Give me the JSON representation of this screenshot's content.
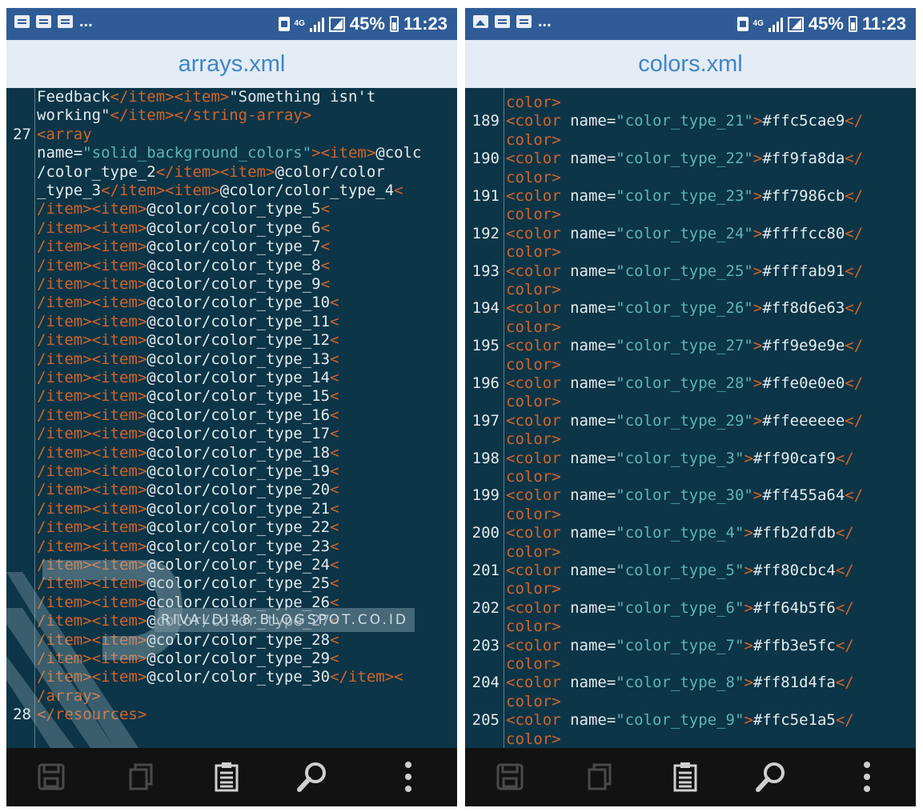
{
  "status_bar": {
    "signal_label": "4G",
    "battery": "45%",
    "time": "11:23",
    "overflow": "..."
  },
  "left_panel": {
    "title": "arrays.xml",
    "lines": [
      {
        "ln": "",
        "parts": [
          [
            "x",
            "Feedback"
          ],
          [
            "t",
            "</item><item>"
          ],
          [
            "x",
            "\"Something isn't"
          ]
        ]
      },
      {
        "ln": "",
        "parts": [
          [
            "x",
            "working\""
          ],
          [
            "t",
            "</item></string-array>"
          ]
        ]
      },
      {
        "ln": "27",
        "parts": [
          [
            "t",
            "<array"
          ]
        ]
      },
      {
        "ln": "",
        "parts": [
          [
            "a",
            "name="
          ],
          [
            "s",
            "\"solid_background_colors\""
          ],
          [
            "t",
            "><item>"
          ],
          [
            "x",
            "@colc"
          ]
        ]
      },
      {
        "ln": "",
        "parts": [
          [
            "x",
            "/color_type_2"
          ],
          [
            "t",
            "</item><item>"
          ],
          [
            "x",
            "@color/color"
          ]
        ]
      },
      {
        "ln": "",
        "parts": [
          [
            "x",
            "_type_3"
          ],
          [
            "t",
            "</item><item>"
          ],
          [
            "x",
            "@color/color_type_4"
          ],
          [
            "t",
            "<"
          ]
        ]
      },
      {
        "ln": "",
        "parts": [
          [
            "t",
            "/item><item>"
          ],
          [
            "x",
            "@color/color_type_5"
          ],
          [
            "t",
            "<"
          ]
        ]
      },
      {
        "ln": "",
        "parts": [
          [
            "t",
            "/item><item>"
          ],
          [
            "x",
            "@color/color_type_6"
          ],
          [
            "t",
            "<"
          ]
        ]
      },
      {
        "ln": "",
        "parts": [
          [
            "t",
            "/item><item>"
          ],
          [
            "x",
            "@color/color_type_7"
          ],
          [
            "t",
            "<"
          ]
        ]
      },
      {
        "ln": "",
        "parts": [
          [
            "t",
            "/item><item>"
          ],
          [
            "x",
            "@color/color_type_8"
          ],
          [
            "t",
            "<"
          ]
        ]
      },
      {
        "ln": "",
        "parts": [
          [
            "t",
            "/item><item>"
          ],
          [
            "x",
            "@color/color_type_9"
          ],
          [
            "t",
            "<"
          ]
        ]
      },
      {
        "ln": "",
        "parts": [
          [
            "t",
            "/item><item>"
          ],
          [
            "x",
            "@color/color_type_10"
          ],
          [
            "t",
            "<"
          ]
        ]
      },
      {
        "ln": "",
        "parts": [
          [
            "t",
            "/item><item>"
          ],
          [
            "x",
            "@color/color_type_11"
          ],
          [
            "t",
            "<"
          ]
        ]
      },
      {
        "ln": "",
        "parts": [
          [
            "t",
            "/item><item>"
          ],
          [
            "x",
            "@color/color_type_12"
          ],
          [
            "t",
            "<"
          ]
        ]
      },
      {
        "ln": "",
        "parts": [
          [
            "t",
            "/item><item>"
          ],
          [
            "x",
            "@color/color_type_13"
          ],
          [
            "t",
            "<"
          ]
        ]
      },
      {
        "ln": "",
        "parts": [
          [
            "t",
            "/item><item>"
          ],
          [
            "x",
            "@color/color_type_14"
          ],
          [
            "t",
            "<"
          ]
        ]
      },
      {
        "ln": "",
        "parts": [
          [
            "t",
            "/item><item>"
          ],
          [
            "x",
            "@color/color_type_15"
          ],
          [
            "t",
            "<"
          ]
        ]
      },
      {
        "ln": "",
        "parts": [
          [
            "t",
            "/item><item>"
          ],
          [
            "x",
            "@color/color_type_16"
          ],
          [
            "t",
            "<"
          ]
        ]
      },
      {
        "ln": "",
        "parts": [
          [
            "t",
            "/item><item>"
          ],
          [
            "x",
            "@color/color_type_17"
          ],
          [
            "t",
            "<"
          ]
        ]
      },
      {
        "ln": "",
        "parts": [
          [
            "t",
            "/item><item>"
          ],
          [
            "x",
            "@color/color_type_18"
          ],
          [
            "t",
            "<"
          ]
        ]
      },
      {
        "ln": "",
        "parts": [
          [
            "t",
            "/item><item>"
          ],
          [
            "x",
            "@color/color_type_19"
          ],
          [
            "t",
            "<"
          ]
        ]
      },
      {
        "ln": "",
        "parts": [
          [
            "t",
            "/item><item>"
          ],
          [
            "x",
            "@color/color_type_20"
          ],
          [
            "t",
            "<"
          ]
        ]
      },
      {
        "ln": "",
        "parts": [
          [
            "t",
            "/item><item>"
          ],
          [
            "x",
            "@color/color_type_21"
          ],
          [
            "t",
            "<"
          ]
        ]
      },
      {
        "ln": "",
        "parts": [
          [
            "t",
            "/item><item>"
          ],
          [
            "x",
            "@color/color_type_22"
          ],
          [
            "t",
            "<"
          ]
        ]
      },
      {
        "ln": "",
        "parts": [
          [
            "t",
            "/item><item>"
          ],
          [
            "x",
            "@color/color_type_23"
          ],
          [
            "t",
            "<"
          ]
        ]
      },
      {
        "ln": "",
        "parts": [
          [
            "t",
            "/item><item>"
          ],
          [
            "x",
            "@color/color_type_24"
          ],
          [
            "t",
            "<"
          ]
        ]
      },
      {
        "ln": "",
        "parts": [
          [
            "t",
            "/item><item>"
          ],
          [
            "x",
            "@color/color_type_25"
          ],
          [
            "t",
            "<"
          ]
        ]
      },
      {
        "ln": "",
        "parts": [
          [
            "t",
            "/item><item>"
          ],
          [
            "x",
            "@color/color_type_26"
          ],
          [
            "t",
            "<"
          ]
        ]
      },
      {
        "ln": "",
        "parts": [
          [
            "t",
            "/item><item>"
          ],
          [
            "x",
            "@color/color_type_27"
          ],
          [
            "t",
            "<"
          ]
        ]
      },
      {
        "ln": "",
        "parts": [
          [
            "t",
            "/item><item>"
          ],
          [
            "x",
            "@color/color_type_28"
          ],
          [
            "t",
            "<"
          ]
        ]
      },
      {
        "ln": "",
        "parts": [
          [
            "t",
            "/item><item>"
          ],
          [
            "x",
            "@color/color_type_29"
          ],
          [
            "t",
            "<"
          ]
        ]
      },
      {
        "ln": "",
        "parts": [
          [
            "t",
            "/item><item>"
          ],
          [
            "x",
            "@color/color_type_30"
          ],
          [
            "t",
            "</item><"
          ]
        ]
      },
      {
        "ln": "",
        "parts": [
          [
            "t",
            "/array>"
          ]
        ]
      },
      {
        "ln": "28",
        "parts": [
          [
            "t",
            "</resources>"
          ]
        ]
      }
    ]
  },
  "right_panel": {
    "title": "colors.xml",
    "lines": [
      {
        "ln": "",
        "parts": [
          [
            "t",
            "color>"
          ]
        ]
      },
      {
        "ln": "189",
        "parts": [
          [
            "t",
            "<color "
          ],
          [
            "a",
            "name="
          ],
          [
            "s",
            "\"color_type_21\""
          ],
          [
            "t",
            ">"
          ],
          [
            "x",
            "#ffc5cae9"
          ],
          [
            "t",
            "</"
          ]
        ]
      },
      {
        "ln": "",
        "parts": [
          [
            "t",
            "color>"
          ]
        ]
      },
      {
        "ln": "190",
        "parts": [
          [
            "t",
            "<color "
          ],
          [
            "a",
            "name="
          ],
          [
            "s",
            "\"color_type_22\""
          ],
          [
            "t",
            ">"
          ],
          [
            "x",
            "#ff9fa8da"
          ],
          [
            "t",
            "</"
          ]
        ]
      },
      {
        "ln": "",
        "parts": [
          [
            "t",
            "color>"
          ]
        ]
      },
      {
        "ln": "191",
        "parts": [
          [
            "t",
            "<color "
          ],
          [
            "a",
            "name="
          ],
          [
            "s",
            "\"color_type_23\""
          ],
          [
            "t",
            ">"
          ],
          [
            "x",
            "#ff7986cb"
          ],
          [
            "t",
            "</"
          ]
        ]
      },
      {
        "ln": "",
        "parts": [
          [
            "t",
            "color>"
          ]
        ]
      },
      {
        "ln": "192",
        "parts": [
          [
            "t",
            "<color "
          ],
          [
            "a",
            "name="
          ],
          [
            "s",
            "\"color_type_24\""
          ],
          [
            "t",
            ">"
          ],
          [
            "x",
            "#ffffcc80"
          ],
          [
            "t",
            "</"
          ]
        ]
      },
      {
        "ln": "",
        "parts": [
          [
            "t",
            "color>"
          ]
        ]
      },
      {
        "ln": "193",
        "parts": [
          [
            "t",
            "<color "
          ],
          [
            "a",
            "name="
          ],
          [
            "s",
            "\"color_type_25\""
          ],
          [
            "t",
            ">"
          ],
          [
            "x",
            "#ffffab91"
          ],
          [
            "t",
            "</"
          ]
        ]
      },
      {
        "ln": "",
        "parts": [
          [
            "t",
            "color>"
          ]
        ]
      },
      {
        "ln": "194",
        "parts": [
          [
            "t",
            "<color "
          ],
          [
            "a",
            "name="
          ],
          [
            "s",
            "\"color_type_26\""
          ],
          [
            "t",
            ">"
          ],
          [
            "x",
            "#ff8d6e63"
          ],
          [
            "t",
            "</"
          ]
        ]
      },
      {
        "ln": "",
        "parts": [
          [
            "t",
            "color>"
          ]
        ]
      },
      {
        "ln": "195",
        "parts": [
          [
            "t",
            "<color "
          ],
          [
            "a",
            "name="
          ],
          [
            "s",
            "\"color_type_27\""
          ],
          [
            "t",
            ">"
          ],
          [
            "x",
            "#ff9e9e9e"
          ],
          [
            "t",
            "</"
          ]
        ]
      },
      {
        "ln": "",
        "parts": [
          [
            "t",
            "color>"
          ]
        ]
      },
      {
        "ln": "196",
        "parts": [
          [
            "t",
            "<color "
          ],
          [
            "a",
            "name="
          ],
          [
            "s",
            "\"color_type_28\""
          ],
          [
            "t",
            ">"
          ],
          [
            "x",
            "#ffe0e0e0"
          ],
          [
            "t",
            "</"
          ]
        ]
      },
      {
        "ln": "",
        "parts": [
          [
            "t",
            "color>"
          ]
        ]
      },
      {
        "ln": "197",
        "parts": [
          [
            "t",
            "<color "
          ],
          [
            "a",
            "name="
          ],
          [
            "s",
            "\"color_type_29\""
          ],
          [
            "t",
            ">"
          ],
          [
            "x",
            "#ffeeeeee"
          ],
          [
            "t",
            "</"
          ]
        ]
      },
      {
        "ln": "",
        "parts": [
          [
            "t",
            "color>"
          ]
        ]
      },
      {
        "ln": "198",
        "parts": [
          [
            "t",
            "<color "
          ],
          [
            "a",
            "name="
          ],
          [
            "s",
            "\"color_type_3\""
          ],
          [
            "t",
            ">"
          ],
          [
            "x",
            "#ff90caf9"
          ],
          [
            "t",
            "</"
          ]
        ]
      },
      {
        "ln": "",
        "parts": [
          [
            "t",
            "color>"
          ]
        ]
      },
      {
        "ln": "199",
        "parts": [
          [
            "t",
            "<color "
          ],
          [
            "a",
            "name="
          ],
          [
            "s",
            "\"color_type_30\""
          ],
          [
            "t",
            ">"
          ],
          [
            "x",
            "#ff455a64"
          ],
          [
            "t",
            "</"
          ]
        ]
      },
      {
        "ln": "",
        "parts": [
          [
            "t",
            "color>"
          ]
        ]
      },
      {
        "ln": "200",
        "parts": [
          [
            "t",
            "<color "
          ],
          [
            "a",
            "name="
          ],
          [
            "s",
            "\"color_type_4\""
          ],
          [
            "t",
            ">"
          ],
          [
            "x",
            "#ffb2dfdb"
          ],
          [
            "t",
            "</"
          ]
        ]
      },
      {
        "ln": "",
        "parts": [
          [
            "t",
            "color>"
          ]
        ]
      },
      {
        "ln": "201",
        "parts": [
          [
            "t",
            "<color "
          ],
          [
            "a",
            "name="
          ],
          [
            "s",
            "\"color_type_5\""
          ],
          [
            "t",
            ">"
          ],
          [
            "x",
            "#ff80cbc4"
          ],
          [
            "t",
            "</"
          ]
        ]
      },
      {
        "ln": "",
        "parts": [
          [
            "t",
            "color>"
          ]
        ]
      },
      {
        "ln": "202",
        "parts": [
          [
            "t",
            "<color "
          ],
          [
            "a",
            "name="
          ],
          [
            "s",
            "\"color_type_6\""
          ],
          [
            "t",
            ">"
          ],
          [
            "x",
            "#ff64b5f6"
          ],
          [
            "t",
            "</"
          ]
        ]
      },
      {
        "ln": "",
        "parts": [
          [
            "t",
            "color>"
          ]
        ]
      },
      {
        "ln": "203",
        "parts": [
          [
            "t",
            "<color "
          ],
          [
            "a",
            "name="
          ],
          [
            "s",
            "\"color_type_7\""
          ],
          [
            "t",
            ">"
          ],
          [
            "x",
            "#ffb3e5fc"
          ],
          [
            "t",
            "</"
          ]
        ]
      },
      {
        "ln": "",
        "parts": [
          [
            "t",
            "color>"
          ]
        ]
      },
      {
        "ln": "204",
        "parts": [
          [
            "t",
            "<color "
          ],
          [
            "a",
            "name="
          ],
          [
            "s",
            "\"color_type_8\""
          ],
          [
            "t",
            ">"
          ],
          [
            "x",
            "#ff81d4fa"
          ],
          [
            "t",
            "</"
          ]
        ]
      },
      {
        "ln": "",
        "parts": [
          [
            "t",
            "color>"
          ]
        ]
      },
      {
        "ln": "205",
        "parts": [
          [
            "t",
            "<color "
          ],
          [
            "a",
            "name="
          ],
          [
            "s",
            "\"color_type_9\""
          ],
          [
            "t",
            ">"
          ],
          [
            "x",
            "#ffc5e1a5"
          ],
          [
            "t",
            "</"
          ]
        ]
      },
      {
        "ln": "",
        "parts": [
          [
            "t",
            "color>"
          ]
        ]
      }
    ]
  },
  "watermark": {
    "text": "RIVALDI48.BLOGSPOT.CO.ID"
  },
  "toolbar": {
    "buttons": [
      {
        "icon": "save-icon"
      },
      {
        "icon": "copy-icon"
      },
      {
        "icon": "clipboard-icon"
      },
      {
        "icon": "search-icon"
      },
      {
        "icon": "more-vertical-icon"
      }
    ]
  },
  "colors": {
    "editor_bg": "#0c3547",
    "status_bar": "#2f5c96",
    "title_bar": "#e4ecf6",
    "title_text": "#3e86c6",
    "tag": "#d4642a",
    "attr_value": "#5fb3b8",
    "text": "#e3ebee",
    "toolbar_bg": "#121212"
  }
}
